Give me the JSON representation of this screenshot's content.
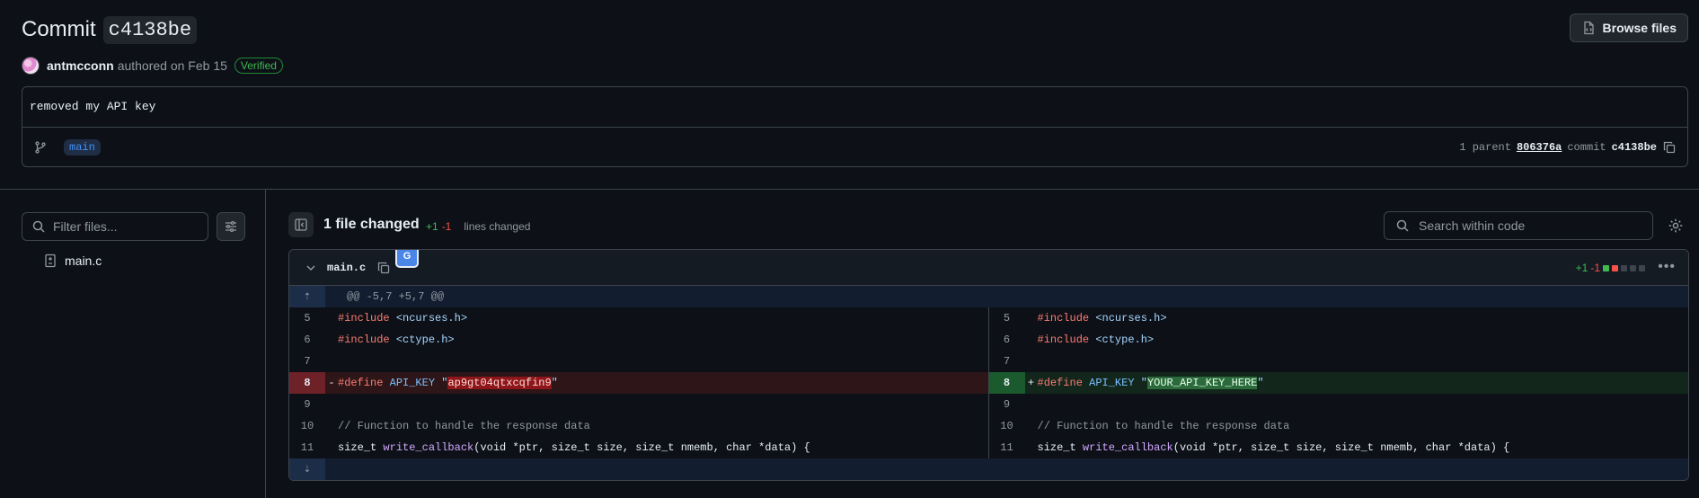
{
  "header": {
    "title": "Commit",
    "sha": "c4138be",
    "browse_files": "Browse files",
    "author": "antmcconn",
    "authored": "authored on Feb 15",
    "verified": "Verified"
  },
  "commit": {
    "message": "removed my API key",
    "branch": "main",
    "parent_label": "1 parent",
    "parent_sha": "806376a",
    "commit_label": "commit",
    "commit_sha": "c4138be"
  },
  "sidebar": {
    "filter_placeholder": "Filter files...",
    "files": [
      {
        "name": "main.c"
      }
    ]
  },
  "diff_toolbar": {
    "files_changed": "1 file changed",
    "additions": "+1",
    "deletions": "-1",
    "lines_changed": "lines changed",
    "search_placeholder": "Search within code"
  },
  "file": {
    "name": "main.c",
    "additions": "+1",
    "deletions": "-1",
    "hunk": "@@ -5,7 +5,7 @@",
    "line_numbers": [
      "5",
      "6",
      "7",
      "8",
      "9",
      "10",
      "11"
    ],
    "lines": {
      "l5": "<ncurses.h>",
      "l6": "<ctype.h>",
      "l10": "// Function to handle the response data",
      "old8_value": "ap9gt04qtxcqfin9",
      "new8_value": "YOUR_API_KEY_HERE"
    },
    "tokens": {
      "include": "#include",
      "define": "#define",
      "macro": "API_KEY",
      "size_t": "size_t",
      "fn": "write_callback",
      "sig_rest_1": "(void *ptr, size_t size, size_t nmemb, char *data) {",
      "minus": "-",
      "plus": "+"
    }
  },
  "colors": {
    "background": "#0d1117",
    "border": "#3d444d",
    "addition": "#3fb950",
    "deletion": "#f85149",
    "link": "#4493f8"
  }
}
